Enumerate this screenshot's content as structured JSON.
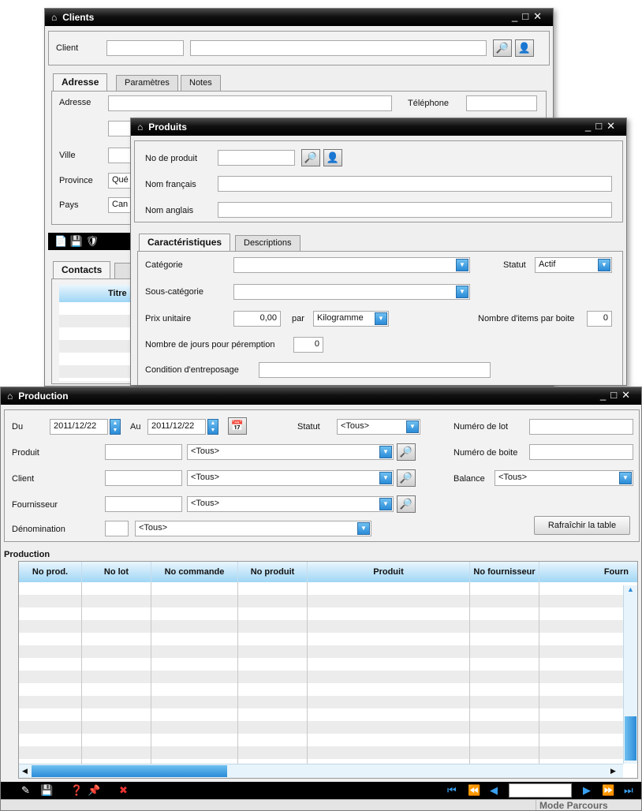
{
  "clients": {
    "title": "Clients",
    "client_label": "Client",
    "tabs": [
      "Adresse",
      "Paramètres",
      "Notes"
    ],
    "adresse_label": "Adresse",
    "telephone_label": "Téléphone",
    "ville_label": "Ville",
    "province_label": "Province",
    "province_value": "Qué",
    "pays_label": "Pays",
    "pays_value": "Can",
    "contacts_tab": "Contacts",
    "titre_col": "Titre"
  },
  "produits": {
    "title": "Produits",
    "no_produit_label": "No de produit",
    "nom_francais_label": "Nom français",
    "nom_anglais_label": "Nom anglais",
    "tabs": [
      "Caractéristiques",
      "Descriptions"
    ],
    "categorie_label": "Catégorie",
    "statut_label": "Statut",
    "statut_value": "Actif",
    "sous_categorie_label": "Sous-catégorie",
    "prix_label": "Prix unitaire",
    "prix_value": "0,00",
    "par_label": "par",
    "unite_value": "Kilogramme",
    "nb_items_label": "Nombre d'items par boite",
    "nb_items_value": "0",
    "nb_jours_label": "Nombre de jours pour péremption",
    "nb_jours_value": "0",
    "condition_label": "Condition d'entreposage"
  },
  "production": {
    "title": "Production",
    "du_label": "Du",
    "du_value": "2011/12/22",
    "au_label": "Au",
    "au_value": "2011/12/22",
    "statut_label": "Statut",
    "statut_value": "<Tous>",
    "numero_lot_label": "Numéro de lot",
    "produit_label": "Produit",
    "produit_value": "<Tous>",
    "numero_boite_label": "Numéro de boite",
    "client_label": "Client",
    "client_value": "<Tous>",
    "balance_label": "Balance",
    "balance_value": "<Tous>",
    "fournisseur_label": "Fournisseur",
    "fournisseur_value": "<Tous>",
    "denomination_label": "Dénomination",
    "denomination_value": "<Tous>",
    "refresh_button": "Rafraîchir la table",
    "section_title": "Production",
    "columns": [
      "No prod.",
      "No lot",
      "No commande",
      "No produit",
      "Produit",
      "No fournisseur",
      "Fourn"
    ],
    "status_text": "Mode Parcours"
  }
}
